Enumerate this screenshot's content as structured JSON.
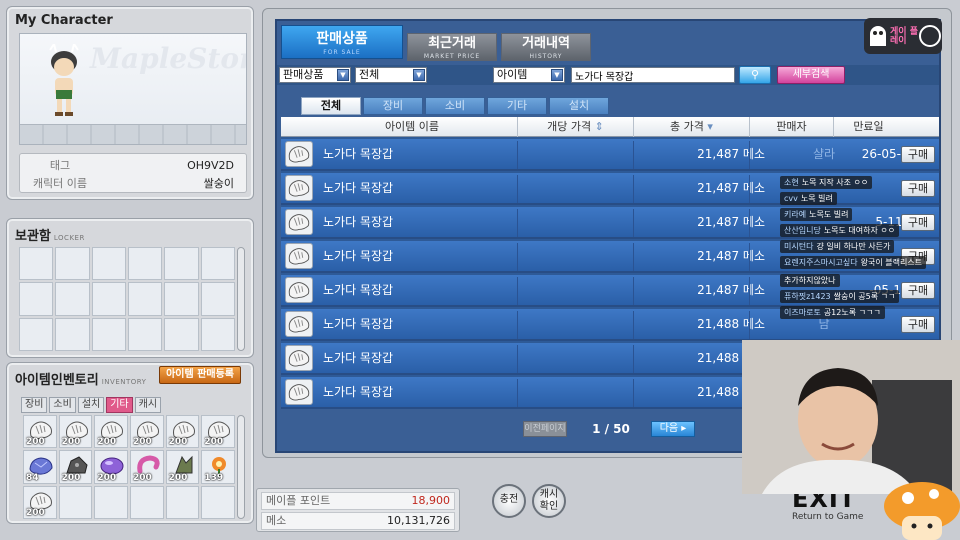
{
  "character": {
    "title": "My Character",
    "logo_text": "MapleStory",
    "tag_label": "태그",
    "tag_value": "OH9V2D",
    "name_label": "캐릭터 이름",
    "name_value": "쌀숭이"
  },
  "locker": {
    "title": "보관함",
    "subtitle": "LOCKER"
  },
  "inventory": {
    "title": "아이템인벤토리",
    "subtitle": "INVENTORY",
    "sell_register_label": "아이템 판매등록",
    "tabs": [
      "장비",
      "소비",
      "설치",
      "기타",
      "캐시"
    ],
    "active_tab": "기타",
    "slots": [
      {
        "icon": "glove-icon",
        "qty": "200"
      },
      {
        "icon": "glove-icon",
        "qty": "200"
      },
      {
        "icon": "glove-icon",
        "qty": "200"
      },
      {
        "icon": "glove-icon",
        "qty": "200"
      },
      {
        "icon": "glove-icon",
        "qty": "200"
      },
      {
        "icon": "glove-icon",
        "qty": "200"
      },
      {
        "icon": "ore-icon",
        "qty": "84"
      },
      {
        "icon": "rock-icon",
        "qty": "200"
      },
      {
        "icon": "gem-icon",
        "qty": "200"
      },
      {
        "icon": "tail-icon",
        "qty": "200"
      },
      {
        "icon": "shrub-icon",
        "qty": "200"
      },
      {
        "icon": "flower-icon",
        "qty": "139"
      },
      {
        "icon": "glove-icon",
        "qty": "200"
      }
    ]
  },
  "market": {
    "tabs": {
      "for_sale": {
        "label": "판매상품",
        "sub": "FOR SALE"
      },
      "market_price": {
        "label": "최근거래",
        "sub": "MARKET PRICE"
      },
      "history": {
        "label": "거래내역",
        "sub": "HISTORY"
      }
    },
    "filters": {
      "category": "판매상품",
      "scope": "전체",
      "field": "아이템",
      "query": "노가다 목장갑",
      "search_icon": "magnifier-icon",
      "advanced_label": "세부검색"
    },
    "category_tabs": [
      "전체",
      "장비",
      "소비",
      "기타",
      "설치"
    ],
    "active_category": "전체",
    "columns": {
      "name": "아이템 이름",
      "unit_price": "개당 가격",
      "total_price": "총 가격",
      "seller": "판매자",
      "expiry": "만료일"
    },
    "rows": [
      {
        "name": "노가다 목장갑",
        "price": "21,487 메소",
        "seller": "샬라",
        "date": "26-05-11",
        "buy": "구매"
      },
      {
        "name": "노가다 목장갑",
        "price": "21,487 메소",
        "seller": "",
        "date": "",
        "buy": "구매"
      },
      {
        "name": "노가다 목장갑",
        "price": "21,487 메소",
        "seller": "",
        "date": "5-11",
        "buy": "구매"
      },
      {
        "name": "노가다 목장갑",
        "price": "21,487 메소",
        "seller": "",
        "date": "",
        "buy": "구매"
      },
      {
        "name": "노가다 목장갑",
        "price": "21,487 메소",
        "seller": "",
        "date": "-05-11",
        "buy": "구매"
      },
      {
        "name": "노가다 목장갑",
        "price": "21,488 메소",
        "seller": "남",
        "date": "",
        "buy": "구매"
      },
      {
        "name": "노가다 목장갑",
        "price": "21,488 메소",
        "seller": "",
        "date": "",
        "buy": ""
      },
      {
        "name": "노가다 목장갑",
        "price": "21,488 메소",
        "seller": "",
        "date": "",
        "buy": ""
      }
    ],
    "pager": {
      "prev": "이전페이지",
      "page": "1 / 50",
      "next": "다음 ▸"
    }
  },
  "wallet": {
    "maple_point_label": "메이플 포인트",
    "maple_point_value": "18,900",
    "meso_label": "메소",
    "meso_value": "10,131,726"
  },
  "buttons": {
    "charge": "충전",
    "cash_check": "캐시 확인"
  },
  "exit": {
    "label": "EXIT",
    "sub": "Return to Game"
  },
  "stream": {
    "logo_text": "게이 플레이",
    "chat": [
      {
        "nick": "소현",
        "text": "노목 지작 사조 ㅇㅇ"
      },
      {
        "nick": "cvv",
        "text": "노목 빌려"
      },
      {
        "nick": "키라예",
        "text": "노목도 빌려"
      },
      {
        "nick": "산산입니당",
        "text": "노목도 대여하자 ㅇㅇ"
      },
      {
        "nick": "미시턴다",
        "text": "걍 일비 하나만 사든가"
      },
      {
        "nick": "요렌지주스마시고싶다",
        "text": "왕국이 블랙리스트"
      },
      {
        "nick": "",
        "text": "추가하지않았나"
      },
      {
        "nick": "퓨하찟z1423",
        "text": "쌀숭이 공5록 ㄱㄱ"
      },
      {
        "nick": "이즈마로토",
        "text": "공12노록 ㄱㄱㄱ"
      }
    ]
  },
  "colors": {
    "panel_blue": "#3a5f95",
    "row_blue": "#2a5fa8",
    "accent_pink": "#d3439d",
    "accent_orange": "#c86815"
  }
}
